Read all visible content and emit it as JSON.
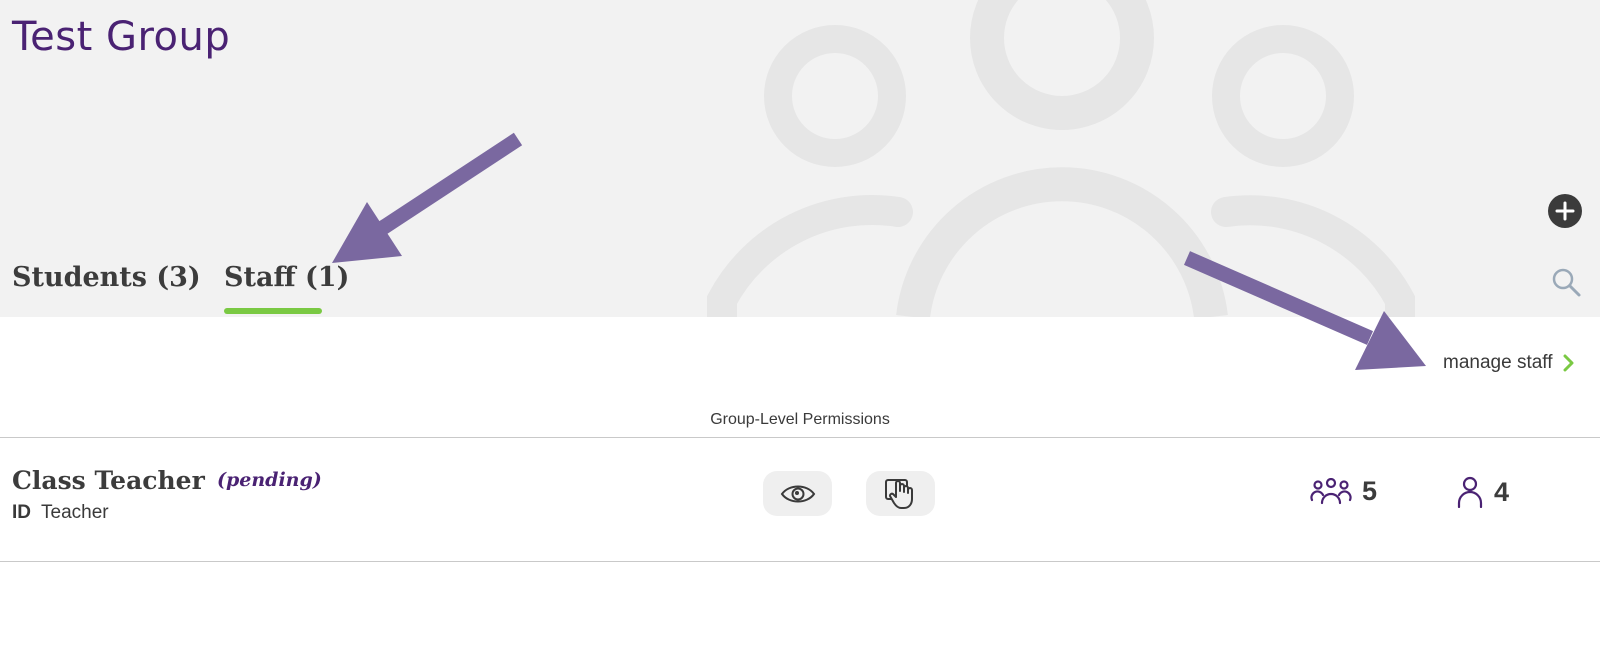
{
  "group": {
    "title": "Test Group"
  },
  "tabs": [
    {
      "label": "Students (3)",
      "active": false
    },
    {
      "label": "Staff (1)",
      "active": true
    }
  ],
  "actions": {
    "add_icon": "plus-icon",
    "search_icon": "search-icon",
    "manage_staff_label": "manage staff",
    "manage_staff_icon": "chevron-right-icon"
  },
  "permissions": {
    "header": "Group-Level Permissions"
  },
  "staff": [
    {
      "name": "Class Teacher",
      "status": "(pending)",
      "id_label": "ID",
      "id_value": "Teacher",
      "permission_icons": [
        "eye-icon",
        "hand-pointer-icon"
      ],
      "student_groups_count": "5",
      "students_count": "4"
    }
  ],
  "colors": {
    "brand_purple": "#4a2273",
    "accent_green": "#7ac943",
    "arrow_purple": "#7a68a0",
    "header_bg": "#f2f2f2"
  }
}
